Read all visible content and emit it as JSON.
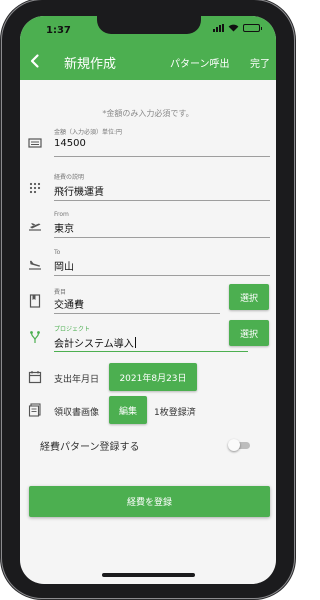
{
  "status": {
    "time": "1:37"
  },
  "appbar": {
    "title": "新規作成",
    "pattern_call": "パターン呼出",
    "done": "完了"
  },
  "note": "*金額のみ入力必須です。",
  "fields": {
    "amount": {
      "label": "金額（入力必須）単位:円",
      "value": "14500"
    },
    "description": {
      "label": "経費の説明",
      "value": "飛行機運賃"
    },
    "from": {
      "label": "From",
      "value": "東京"
    },
    "to": {
      "label": "To",
      "value": "岡山"
    },
    "expense_item": {
      "label": "費目",
      "value": "交通費",
      "button": "選択"
    },
    "project": {
      "label": "プロジェクト",
      "value": "会計システム導入",
      "button": "選択"
    }
  },
  "payment_date": {
    "label": "支出年月日",
    "value": "2021年8月23日"
  },
  "receipt": {
    "label": "領収書画像",
    "button": "編集",
    "count": "1枚登録済"
  },
  "pattern_toggle": {
    "label": "経費パターン登録する",
    "on": false
  },
  "register_button": "経費を登録",
  "colors": {
    "accent": "#4caf50",
    "background": "#f5f5f5"
  },
  "icons": [
    "back-arrow-icon",
    "amount-icon",
    "description-icon",
    "departure-icon",
    "arrival-icon",
    "expense-item-icon",
    "project-icon",
    "calendar-icon",
    "receipt-icon"
  ]
}
